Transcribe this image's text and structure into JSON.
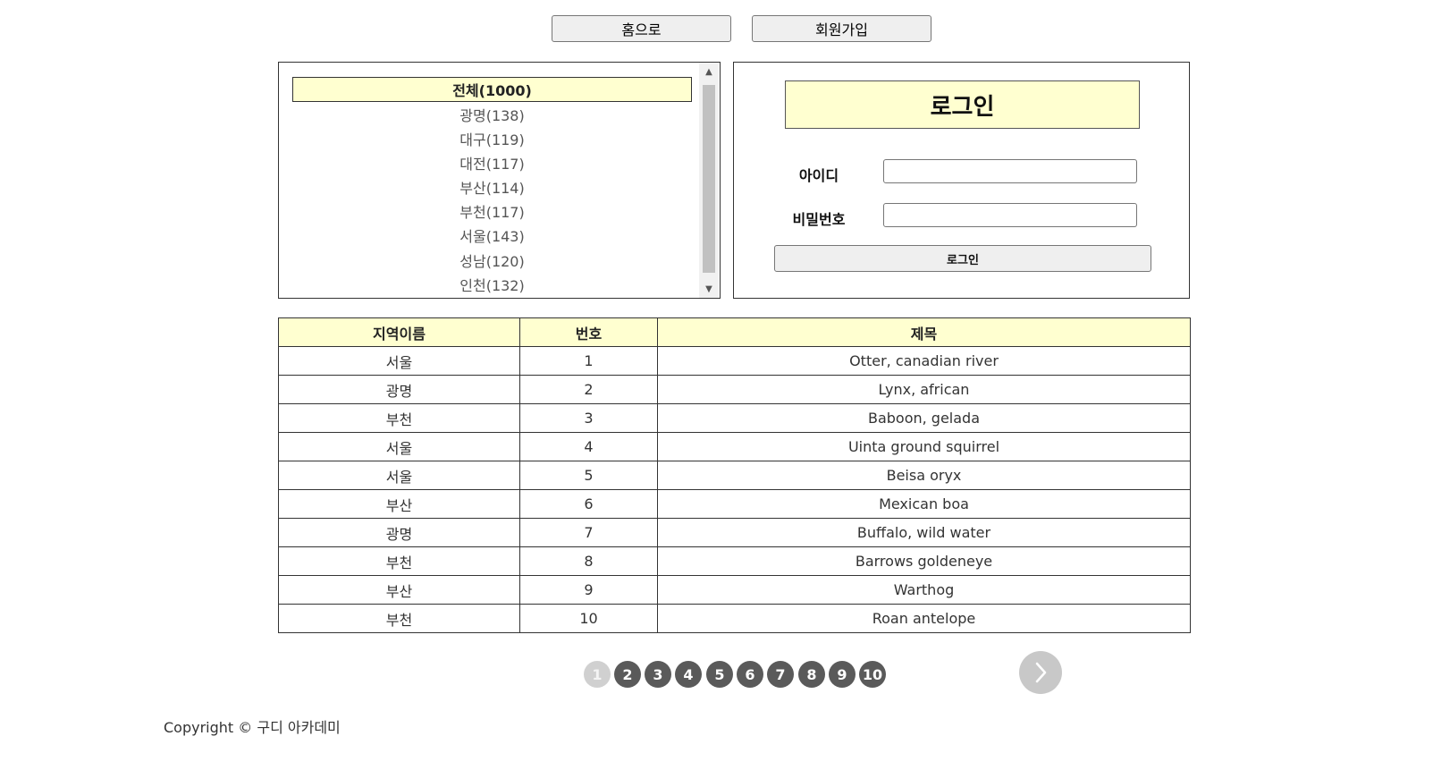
{
  "top_nav": {
    "home_label": "홈으로",
    "signup_label": "회원가입"
  },
  "regions": [
    {
      "label": "전체(1000)",
      "selected": true
    },
    {
      "label": "광명(138)"
    },
    {
      "label": "대구(119)"
    },
    {
      "label": "대전(117)"
    },
    {
      "label": "부산(114)"
    },
    {
      "label": "부천(117)"
    },
    {
      "label": "서울(143)"
    },
    {
      "label": "성남(120)"
    },
    {
      "label": "인천(132)"
    }
  ],
  "login": {
    "title": "로그인",
    "id_label": "아이디",
    "password_label": "비밀번호",
    "id_value": "",
    "password_value": "",
    "submit_label": "로그인"
  },
  "table": {
    "headers": [
      "지역이름",
      "번호",
      "제목"
    ],
    "rows": [
      [
        "서울",
        "1",
        "Otter, canadian river"
      ],
      [
        "광명",
        "2",
        "Lynx, african"
      ],
      [
        "부천",
        "3",
        "Baboon, gelada"
      ],
      [
        "서울",
        "4",
        "Uinta ground squirrel"
      ],
      [
        "서울",
        "5",
        "Beisa oryx"
      ],
      [
        "부산",
        "6",
        "Mexican boa"
      ],
      [
        "광명",
        "7",
        "Buffalo, wild water"
      ],
      [
        "부천",
        "8",
        "Barrows goldeneye"
      ],
      [
        "부산",
        "9",
        "Warthog"
      ],
      [
        "부천",
        "10",
        "Roan antelope"
      ]
    ]
  },
  "pagination": {
    "pages": [
      "1",
      "2",
      "3",
      "4",
      "5",
      "6",
      "7",
      "8",
      "9",
      "10"
    ],
    "current": "1",
    "next_icon": "chevron-right-icon"
  },
  "footer": {
    "copyright": "Copyright © 구디 아카데미"
  },
  "colors": {
    "highlight": "#ffffd0",
    "page_dot": "#5a5a5a",
    "page_current": "#d0d0d0"
  }
}
